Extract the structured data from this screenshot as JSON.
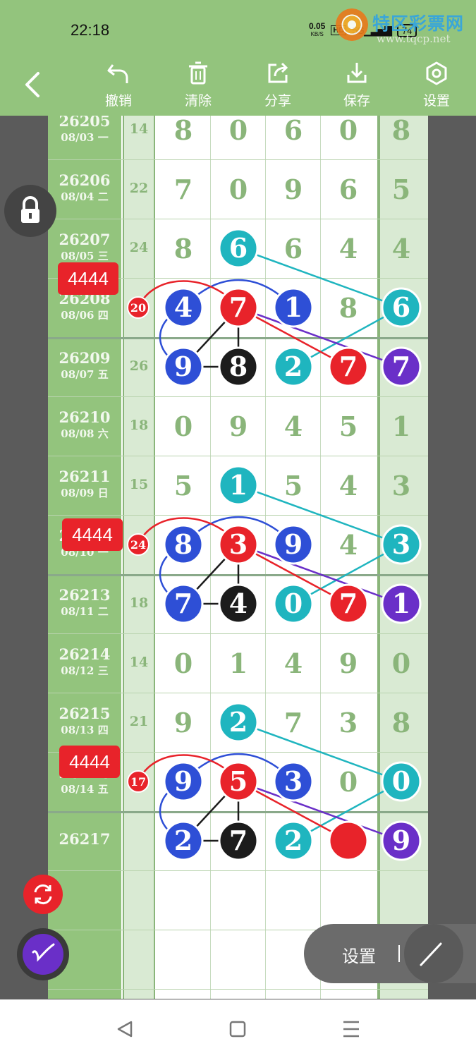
{
  "status_bar": {
    "time": "22:18",
    "net_speed": "0.05",
    "net_unit": "KB/S",
    "hd": "HD",
    "signal": "5G",
    "battery": "74"
  },
  "watermark": {
    "title": "特区彩票网",
    "url": "www.tqcp.net"
  },
  "toolbar": {
    "undo_label": "撤销",
    "clear_label": "清除",
    "share_label": "分享",
    "save_label": "保存",
    "settings_label": "设置"
  },
  "rows": [
    {
      "issue": "26205",
      "date": "08/03 一",
      "sum": "14",
      "digits": [
        "8",
        "0",
        "6",
        "0",
        "8"
      ]
    },
    {
      "issue": "26206",
      "date": "08/04 二",
      "sum": "22",
      "digits": [
        "7",
        "0",
        "9",
        "6",
        "5"
      ]
    },
    {
      "issue": "26207",
      "date": "08/05 三",
      "sum": "24",
      "digits": [
        "8",
        "6",
        "6",
        "4",
        "4"
      ]
    },
    {
      "issue": "26208",
      "date": "08/06 四",
      "sum": "20",
      "digits": [
        "4",
        "7",
        "1",
        "8",
        "6"
      ]
    },
    {
      "issue": "26209",
      "date": "08/07 五",
      "sum": "26",
      "digits": [
        "9",
        "8",
        "2",
        "7",
        "7"
      ]
    },
    {
      "issue": "26210",
      "date": "08/08 六",
      "sum": "18",
      "digits": [
        "0",
        "9",
        "4",
        "5",
        "1"
      ]
    },
    {
      "issue": "26211",
      "date": "08/09 日",
      "sum": "15",
      "digits": [
        "5",
        "1",
        "5",
        "4",
        "3"
      ]
    },
    {
      "issue": "26212",
      "date": "08/10 一",
      "sum": "24",
      "digits": [
        "8",
        "3",
        "9",
        "4",
        "3"
      ]
    },
    {
      "issue": "26213",
      "date": "08/11 二",
      "sum": "18",
      "digits": [
        "7",
        "4",
        "0",
        "7",
        "1"
      ]
    },
    {
      "issue": "26214",
      "date": "08/12 三",
      "sum": "14",
      "digits": [
        "0",
        "1",
        "4",
        "9",
        "0"
      ]
    },
    {
      "issue": "26215",
      "date": "08/13 四",
      "sum": "21",
      "digits": [
        "9",
        "2",
        "7",
        "3",
        "8"
      ]
    },
    {
      "issue": "26216",
      "date": "08/14 五",
      "sum": "17",
      "digits": [
        "9",
        "5",
        "3",
        "0",
        "0"
      ]
    },
    {
      "issue": "26217",
      "date": "",
      "sum": "",
      "digits": [
        "2",
        "7",
        "2",
        "",
        "9"
      ]
    },
    {
      "issue": "",
      "date": "",
      "sum": "",
      "digits": [
        "",
        "",
        "",
        "",
        ""
      ]
    },
    {
      "issue": "",
      "date": "",
      "sum": "",
      "digits": [
        "",
        "",
        "",
        "",
        ""
      ]
    }
  ],
  "tags": [
    "4444",
    "4444",
    "4444"
  ],
  "floating_panel": {
    "settings_label": "设置",
    "separator": "|"
  },
  "colors": {
    "header_green": "#93c47d",
    "light_green": "#d9ead3",
    "digit_green": "#8ab57a",
    "blue_ball": "#2e4fd6",
    "red_ball": "#e8232a",
    "black_ball": "#1c1c1c",
    "cyan_ball": "#1fb5bf",
    "purple_ball": "#6a2fc8"
  }
}
